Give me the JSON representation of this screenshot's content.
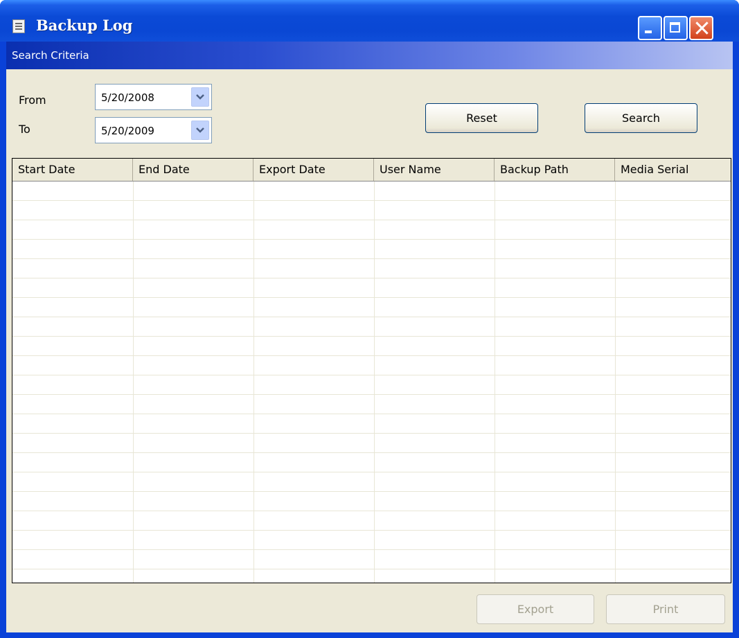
{
  "window": {
    "title": "Backup Log",
    "icon": "log-icon"
  },
  "criteria": {
    "header": "Search Criteria",
    "from_label": "From",
    "from_value": "5/20/2008",
    "to_label": "To",
    "to_value": "5/20/2009",
    "reset_label": "Reset",
    "search_label": "Search"
  },
  "grid": {
    "columns": [
      "Start Date",
      "End Date",
      "Export Date",
      "User Name",
      "Backup Path",
      "Media Serial"
    ],
    "rows": []
  },
  "footer": {
    "export_label": "Export",
    "print_label": "Print"
  }
}
